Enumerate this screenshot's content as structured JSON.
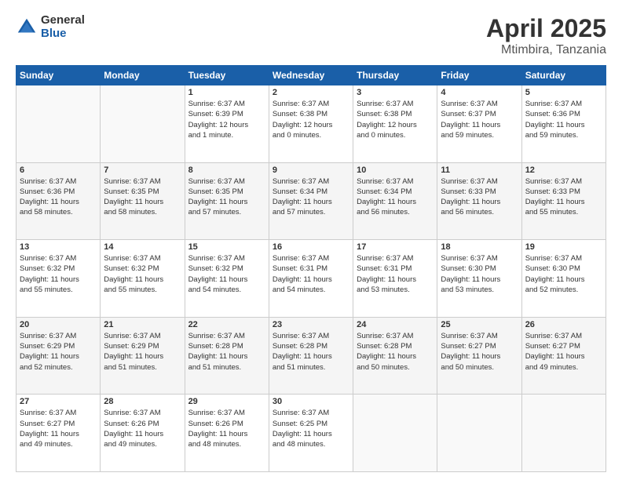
{
  "logo": {
    "general": "General",
    "blue": "Blue"
  },
  "title": "April 2025",
  "subtitle": "Mtimbira, Tanzania",
  "days_header": [
    "Sunday",
    "Monday",
    "Tuesday",
    "Wednesday",
    "Thursday",
    "Friday",
    "Saturday"
  ],
  "weeks": [
    [
      {
        "day": "",
        "info": ""
      },
      {
        "day": "",
        "info": ""
      },
      {
        "day": "1",
        "info": "Sunrise: 6:37 AM\nSunset: 6:39 PM\nDaylight: 12 hours\nand 1 minute."
      },
      {
        "day": "2",
        "info": "Sunrise: 6:37 AM\nSunset: 6:38 PM\nDaylight: 12 hours\nand 0 minutes."
      },
      {
        "day": "3",
        "info": "Sunrise: 6:37 AM\nSunset: 6:38 PM\nDaylight: 12 hours\nand 0 minutes."
      },
      {
        "day": "4",
        "info": "Sunrise: 6:37 AM\nSunset: 6:37 PM\nDaylight: 11 hours\nand 59 minutes."
      },
      {
        "day": "5",
        "info": "Sunrise: 6:37 AM\nSunset: 6:36 PM\nDaylight: 11 hours\nand 59 minutes."
      }
    ],
    [
      {
        "day": "6",
        "info": "Sunrise: 6:37 AM\nSunset: 6:36 PM\nDaylight: 11 hours\nand 58 minutes."
      },
      {
        "day": "7",
        "info": "Sunrise: 6:37 AM\nSunset: 6:35 PM\nDaylight: 11 hours\nand 58 minutes."
      },
      {
        "day": "8",
        "info": "Sunrise: 6:37 AM\nSunset: 6:35 PM\nDaylight: 11 hours\nand 57 minutes."
      },
      {
        "day": "9",
        "info": "Sunrise: 6:37 AM\nSunset: 6:34 PM\nDaylight: 11 hours\nand 57 minutes."
      },
      {
        "day": "10",
        "info": "Sunrise: 6:37 AM\nSunset: 6:34 PM\nDaylight: 11 hours\nand 56 minutes."
      },
      {
        "day": "11",
        "info": "Sunrise: 6:37 AM\nSunset: 6:33 PM\nDaylight: 11 hours\nand 56 minutes."
      },
      {
        "day": "12",
        "info": "Sunrise: 6:37 AM\nSunset: 6:33 PM\nDaylight: 11 hours\nand 55 minutes."
      }
    ],
    [
      {
        "day": "13",
        "info": "Sunrise: 6:37 AM\nSunset: 6:32 PM\nDaylight: 11 hours\nand 55 minutes."
      },
      {
        "day": "14",
        "info": "Sunrise: 6:37 AM\nSunset: 6:32 PM\nDaylight: 11 hours\nand 55 minutes."
      },
      {
        "day": "15",
        "info": "Sunrise: 6:37 AM\nSunset: 6:32 PM\nDaylight: 11 hours\nand 54 minutes."
      },
      {
        "day": "16",
        "info": "Sunrise: 6:37 AM\nSunset: 6:31 PM\nDaylight: 11 hours\nand 54 minutes."
      },
      {
        "day": "17",
        "info": "Sunrise: 6:37 AM\nSunset: 6:31 PM\nDaylight: 11 hours\nand 53 minutes."
      },
      {
        "day": "18",
        "info": "Sunrise: 6:37 AM\nSunset: 6:30 PM\nDaylight: 11 hours\nand 53 minutes."
      },
      {
        "day": "19",
        "info": "Sunrise: 6:37 AM\nSunset: 6:30 PM\nDaylight: 11 hours\nand 52 minutes."
      }
    ],
    [
      {
        "day": "20",
        "info": "Sunrise: 6:37 AM\nSunset: 6:29 PM\nDaylight: 11 hours\nand 52 minutes."
      },
      {
        "day": "21",
        "info": "Sunrise: 6:37 AM\nSunset: 6:29 PM\nDaylight: 11 hours\nand 51 minutes."
      },
      {
        "day": "22",
        "info": "Sunrise: 6:37 AM\nSunset: 6:28 PM\nDaylight: 11 hours\nand 51 minutes."
      },
      {
        "day": "23",
        "info": "Sunrise: 6:37 AM\nSunset: 6:28 PM\nDaylight: 11 hours\nand 51 minutes."
      },
      {
        "day": "24",
        "info": "Sunrise: 6:37 AM\nSunset: 6:28 PM\nDaylight: 11 hours\nand 50 minutes."
      },
      {
        "day": "25",
        "info": "Sunrise: 6:37 AM\nSunset: 6:27 PM\nDaylight: 11 hours\nand 50 minutes."
      },
      {
        "day": "26",
        "info": "Sunrise: 6:37 AM\nSunset: 6:27 PM\nDaylight: 11 hours\nand 49 minutes."
      }
    ],
    [
      {
        "day": "27",
        "info": "Sunrise: 6:37 AM\nSunset: 6:27 PM\nDaylight: 11 hours\nand 49 minutes."
      },
      {
        "day": "28",
        "info": "Sunrise: 6:37 AM\nSunset: 6:26 PM\nDaylight: 11 hours\nand 49 minutes."
      },
      {
        "day": "29",
        "info": "Sunrise: 6:37 AM\nSunset: 6:26 PM\nDaylight: 11 hours\nand 48 minutes."
      },
      {
        "day": "30",
        "info": "Sunrise: 6:37 AM\nSunset: 6:25 PM\nDaylight: 11 hours\nand 48 minutes."
      },
      {
        "day": "",
        "info": ""
      },
      {
        "day": "",
        "info": ""
      },
      {
        "day": "",
        "info": ""
      }
    ]
  ]
}
